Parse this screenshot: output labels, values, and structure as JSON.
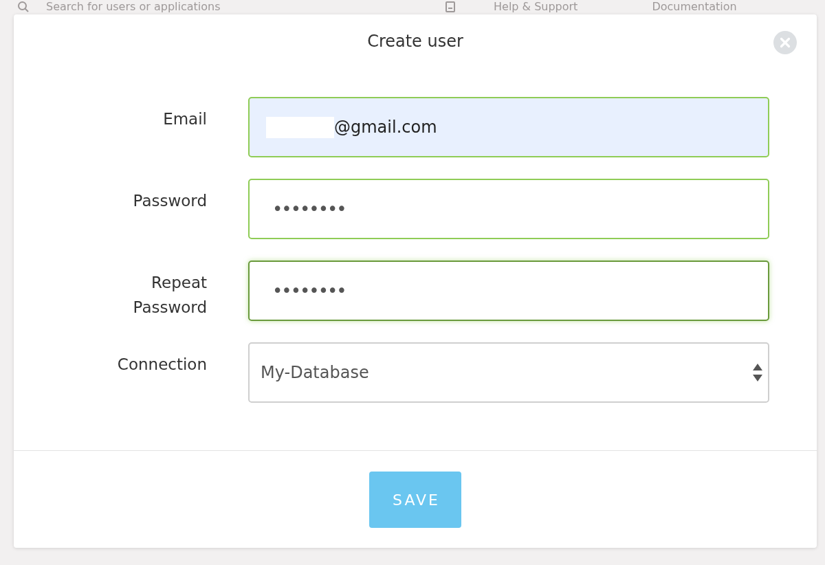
{
  "background": {
    "search": {
      "placeholder": "Search for users or applications"
    },
    "links": [
      "Help & Support",
      "Documentation"
    ]
  },
  "dialog": {
    "title": "Create user",
    "fields": [
      {
        "label": "Email",
        "kind": "email",
        "value": "@gmail.com",
        "redacted": true,
        "autofilled": true,
        "validated": true,
        "focused": false
      },
      {
        "label": "Password",
        "kind": "password",
        "value": "••••••••",
        "redacted": false,
        "autofilled": false,
        "validated": true,
        "focused": false
      },
      {
        "label": "Repeat Password",
        "kind": "password",
        "value": "••••••••",
        "redacted": false,
        "autofilled": false,
        "validated": true,
        "focused": true
      },
      {
        "label": "Connection",
        "kind": "select",
        "value": "My-Database",
        "redacted": false,
        "autofilled": false,
        "validated": false,
        "focused": false
      }
    ],
    "save_button": "SAVE"
  }
}
